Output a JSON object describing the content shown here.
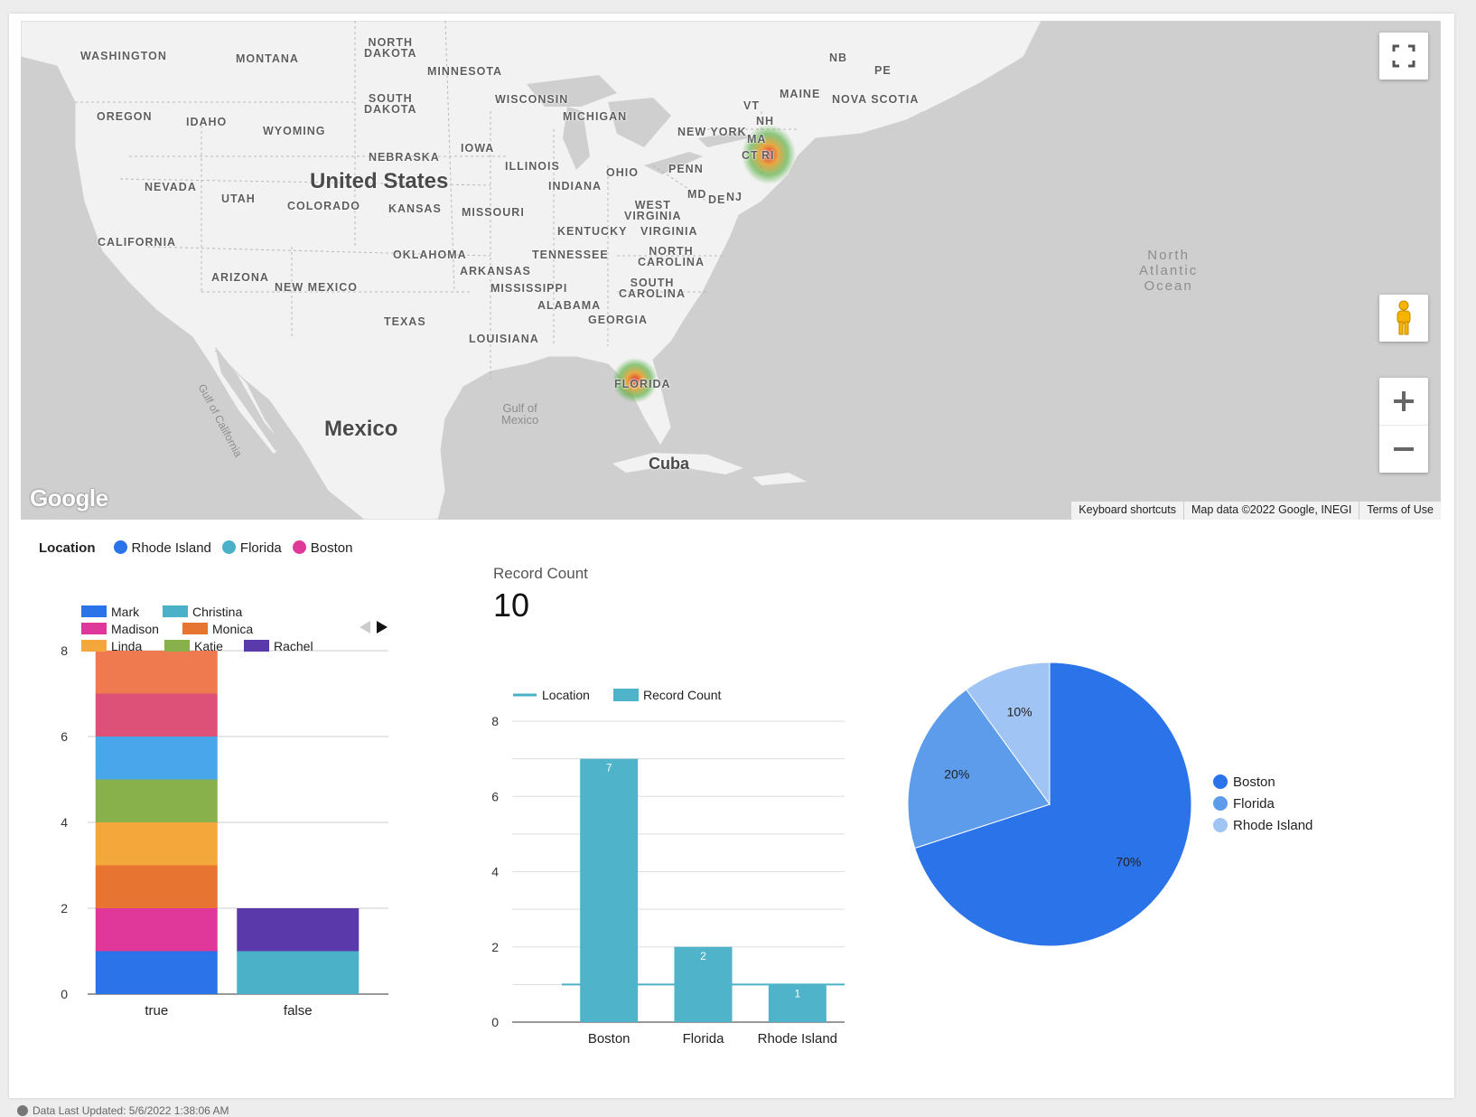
{
  "map": {
    "labels": {
      "washington": "WASHINGTON",
      "montana": "MONTANA",
      "north_dakota": "NORTH\nDAKOTA",
      "minnesota": "MINNESOTA",
      "oregon": "OREGON",
      "idaho": "IDAHO",
      "wyoming": "WYOMING",
      "south_dakota": "SOUTH\nDAKOTA",
      "wisconsin": "WISCONSIN",
      "michigan": "MICHIGAN",
      "iowa": "IOWA",
      "nebraska": "NEBRASKA",
      "nevada": "NEVADA",
      "utah": "UTAH",
      "colorado": "COLORADO",
      "kansas": "KANSAS",
      "illinois": "ILLINOIS",
      "indiana": "INDIANA",
      "ohio": "OHIO",
      "penn": "PENN",
      "new_york": "NEW YORK",
      "vt": "VT",
      "nh": "NH",
      "ma": "MA",
      "ct": "CT",
      "ri": "RI",
      "maine": "MAINE",
      "nb": "NB",
      "pe": "PE",
      "nova_scotia": "NOVA SCOTIA",
      "md": "MD",
      "de": "DE",
      "nj": "NJ",
      "missouri": "MISSOURI",
      "west_virginia": "WEST\nVIRGINIA",
      "kentucky": "KENTUCKY",
      "virginia": "VIRGINIA",
      "california": "CALIFORNIA",
      "oklahoma": "OKLAHOMA",
      "tennessee": "TENNESSEE",
      "north_carolina": "NORTH\nCAROLINA",
      "arizona": "ARIZONA",
      "new_mexico": "NEW MEXICO",
      "arkansas": "ARKANSAS",
      "mississippi": "MISSISSIPPI",
      "south_carolina": "SOUTH\nCAROLINA",
      "alabama": "ALABAMA",
      "georgia": "GEORGIA",
      "texas": "TEXAS",
      "louisiana": "LOUISIANA",
      "florida": "FLORIDA",
      "united_states": "United States",
      "mexico": "Mexico",
      "cuba": "Cuba",
      "gulf_mexico": "Gulf of\nMexico",
      "gulf_california": "Gulf of California",
      "north_atlantic": "North\nAtlantic\nOcean"
    },
    "google_logo": "Google",
    "attribution": [
      "Keyboard shortcuts",
      "Map data ©2022 Google, INEGI",
      "Terms of Use"
    ],
    "icons": {
      "fullscreen": "fullscreen-icon",
      "pegman": "pegman-icon",
      "zoom_in": "plus-icon",
      "zoom_out": "minus-icon"
    }
  },
  "location_legend": {
    "title": "Location",
    "items": [
      {
        "label": "Rhode Island",
        "color": "#2a73e8"
      },
      {
        "label": "Florida",
        "color": "#4bb1c8"
      },
      {
        "label": "Boston",
        "color": "#e0389a"
      }
    ]
  },
  "scorecard": {
    "label": "Record Count",
    "value": "10"
  },
  "chart_data": [
    {
      "type": "bar",
      "stacked": true,
      "categories": [
        "true",
        "false"
      ],
      "ylim": [
        0,
        8
      ],
      "yticks": [
        "0",
        "2",
        "4",
        "6",
        "8"
      ],
      "legend_position": "top-left",
      "series": [
        {
          "name": "Mark",
          "color": "#2a73e8",
          "values": [
            1,
            0
          ]
        },
        {
          "name": "Christina",
          "color": "#4bb1c8",
          "values": [
            0,
            1
          ]
        },
        {
          "name": "Madison",
          "color": "#e0389a",
          "values": [
            1,
            0
          ]
        },
        {
          "name": "Monica",
          "color": "#e87432",
          "values": [
            1,
            0
          ]
        },
        {
          "name": "Linda",
          "color": "#f4a73b",
          "values": [
            1,
            0
          ]
        },
        {
          "name": "Katie",
          "color": "#88b04b",
          "values": [
            1,
            0
          ]
        },
        {
          "name": "Rachel",
          "color": "#5a3aab",
          "values": [
            0,
            1
          ]
        },
        {
          "name": "",
          "color": "#4aa6ea",
          "values": [
            1,
            0
          ]
        },
        {
          "name": "",
          "color": "#dd5178",
          "values": [
            1,
            0
          ]
        },
        {
          "name": "",
          "color": "#f07a50",
          "values": [
            1,
            0
          ]
        }
      ]
    },
    {
      "type": "bar",
      "categories": [
        "Boston",
        "Florida",
        "Rhode Island"
      ],
      "ylim": [
        0,
        8
      ],
      "yticks": [
        "0",
        "2",
        "4",
        "6",
        "8"
      ],
      "legend_position": "top-left",
      "series": [
        {
          "name": "Location",
          "kind": "line",
          "color": "#4bb1c8",
          "values": [
            1,
            1,
            1
          ]
        },
        {
          "name": "Record Count",
          "kind": "bar",
          "color": "#4fb3c9",
          "values": [
            7,
            2,
            1
          ],
          "data_labels": [
            "7",
            "2",
            "1"
          ]
        }
      ]
    },
    {
      "type": "pie",
      "categories": [
        "Boston",
        "Florida",
        "Rhode Island"
      ],
      "values": [
        70,
        20,
        10
      ],
      "labels": [
        "70%",
        "20%",
        "10%"
      ],
      "colors": [
        "#2a73e8",
        "#5c9ceb",
        "#a0c4f3"
      ],
      "legend_position": "right"
    }
  ],
  "footer": {
    "text": "Data Last Updated: 5/6/2022 1:38:06 AM"
  }
}
